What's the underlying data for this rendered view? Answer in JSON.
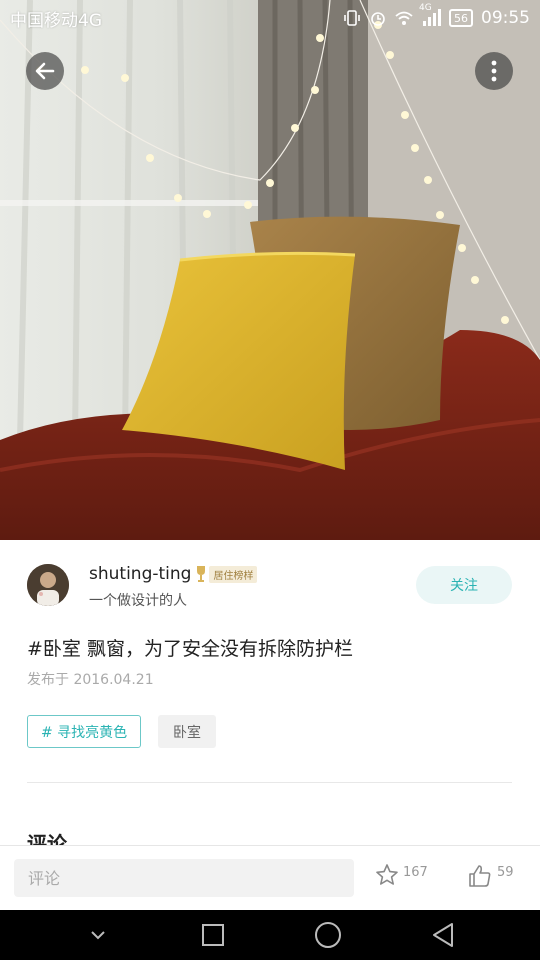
{
  "status_bar": {
    "carrier": "中国移动4G",
    "network": "4G",
    "battery": "56",
    "time": "09:55",
    "icons": [
      "vibrate-icon",
      "alarm-icon",
      "wifi-icon",
      "signal-icon",
      "battery-icon"
    ]
  },
  "top_actions": {
    "back_icon": "arrow-left-icon",
    "more_icon": "more-vertical-icon"
  },
  "author": {
    "name": "shuting-ting",
    "badge": "居住榜样",
    "bio": "一个做设计的人",
    "follow_label": "关注"
  },
  "post": {
    "title": "#卧室 飘窗，为了安全没有拆除防护栏",
    "date": "发布于 2016.04.21",
    "tags": [
      {
        "label": "# 寻找亮黄色",
        "style": "topic"
      },
      {
        "label": "卧室",
        "style": "plain"
      }
    ]
  },
  "comments": {
    "heading": "评论"
  },
  "action_bar": {
    "comment_placeholder": "评论",
    "favorite_count": "167",
    "like_count": "59"
  },
  "theme": {
    "accent": "#2ab3b3",
    "accent_bg": "#eaf6f6"
  }
}
